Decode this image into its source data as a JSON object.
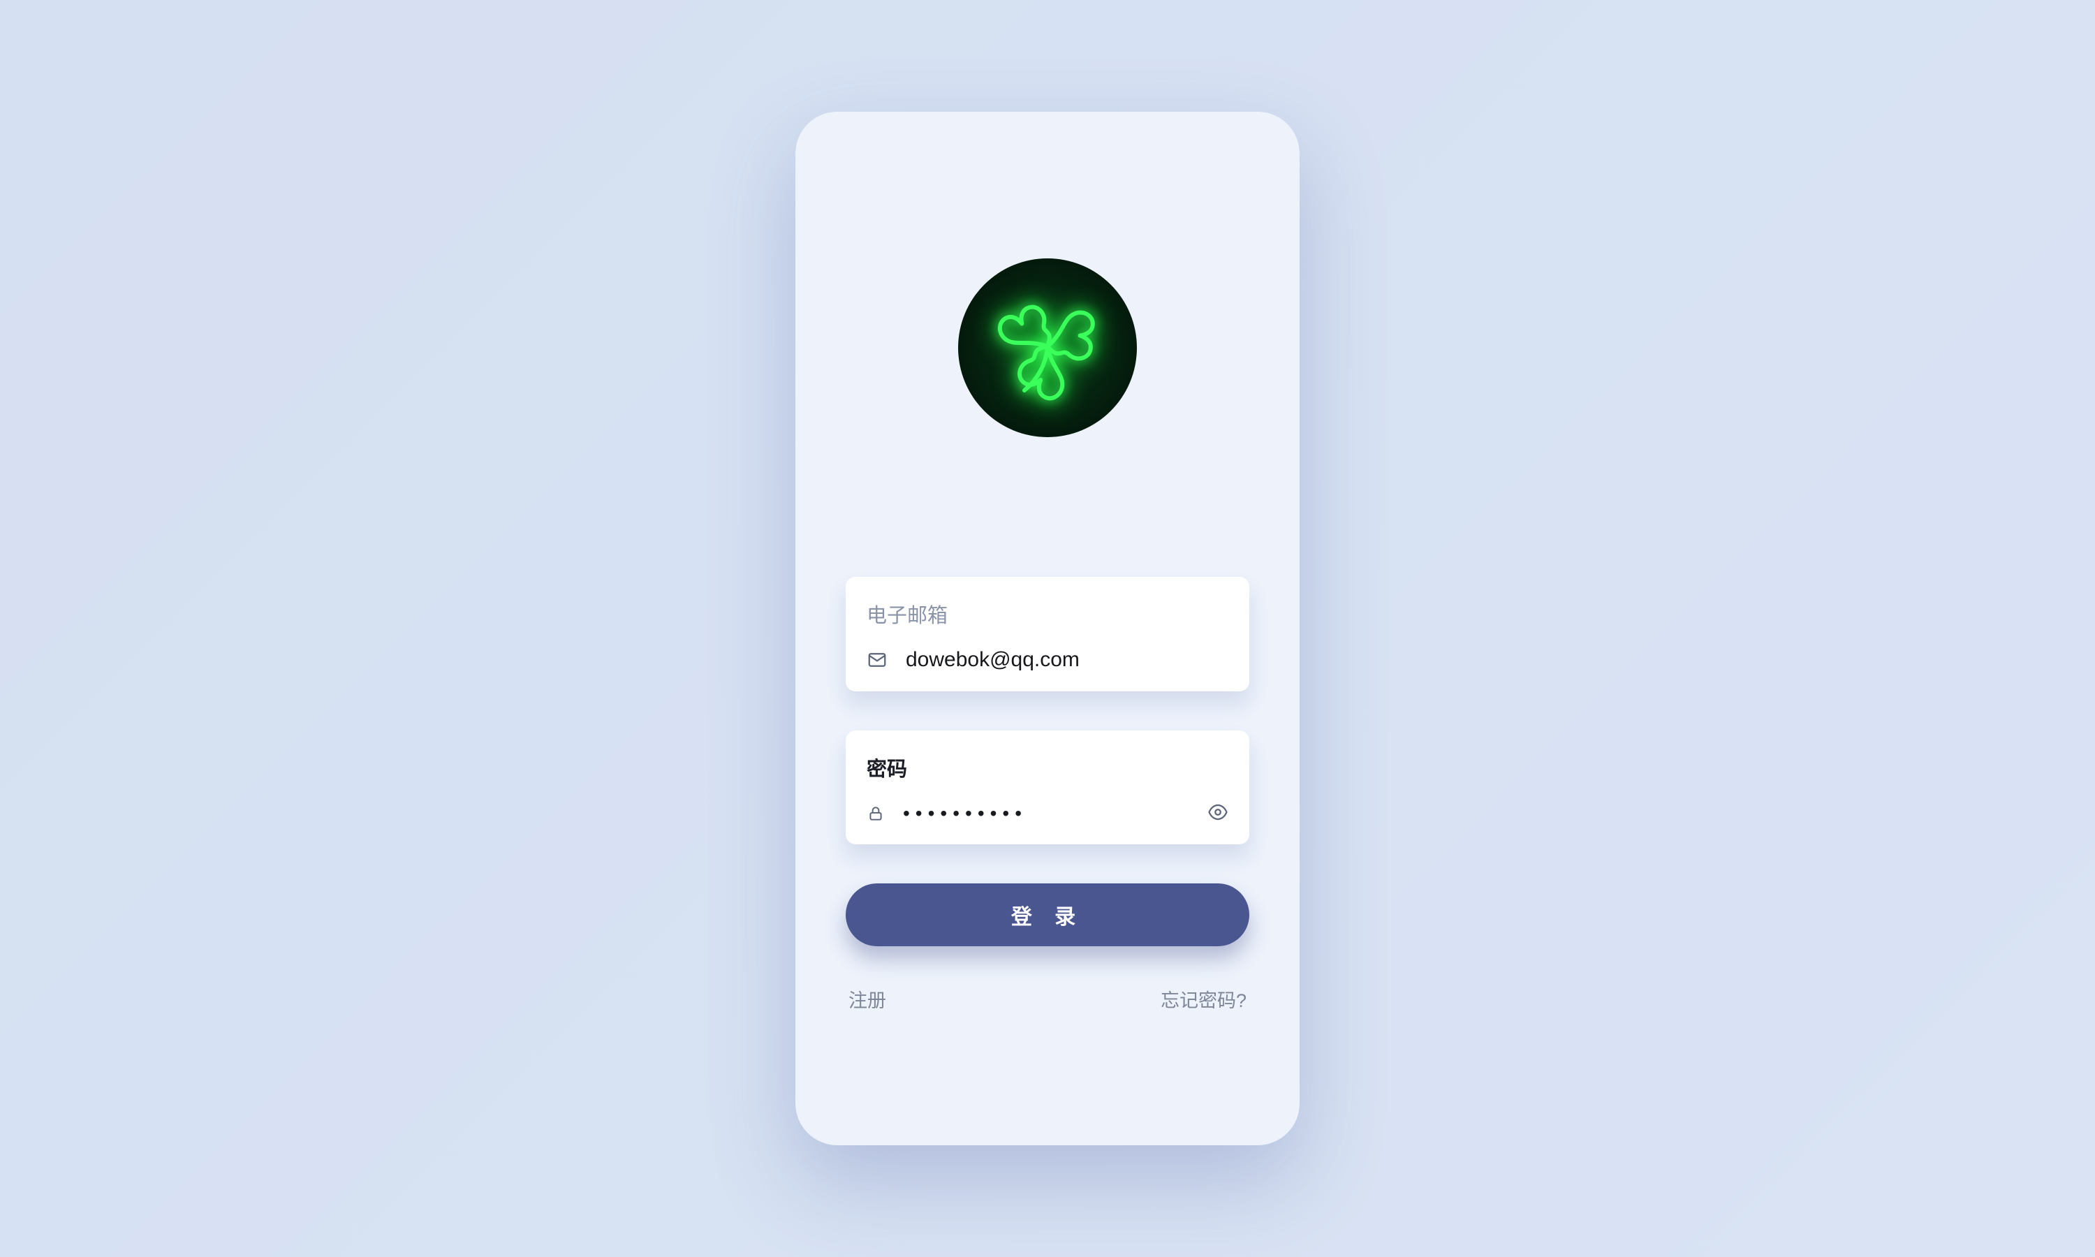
{
  "avatar": {
    "icon": "shamrock-icon",
    "colors": {
      "neon": "#3bff5a",
      "bg_inner": "#0a3a1a",
      "bg_outer": "#020e06"
    }
  },
  "email": {
    "label": "电子邮箱",
    "value": "dowebok@qq.com",
    "icon": "envelope-icon"
  },
  "password": {
    "label": "密码",
    "value": "●●●●●●●●●●",
    "icon": "lock-icon",
    "toggle_icon": "eye-icon"
  },
  "actions": {
    "login_label": "登 录",
    "register_label": "注册",
    "forgot_label": "忘记密码?"
  },
  "colors": {
    "page_bg": "#d9e3f4",
    "card_bg": "#edf2fb",
    "btn_bg": "#4a5690",
    "text_muted": "#8a93a8",
    "text_dark": "#16171b"
  }
}
